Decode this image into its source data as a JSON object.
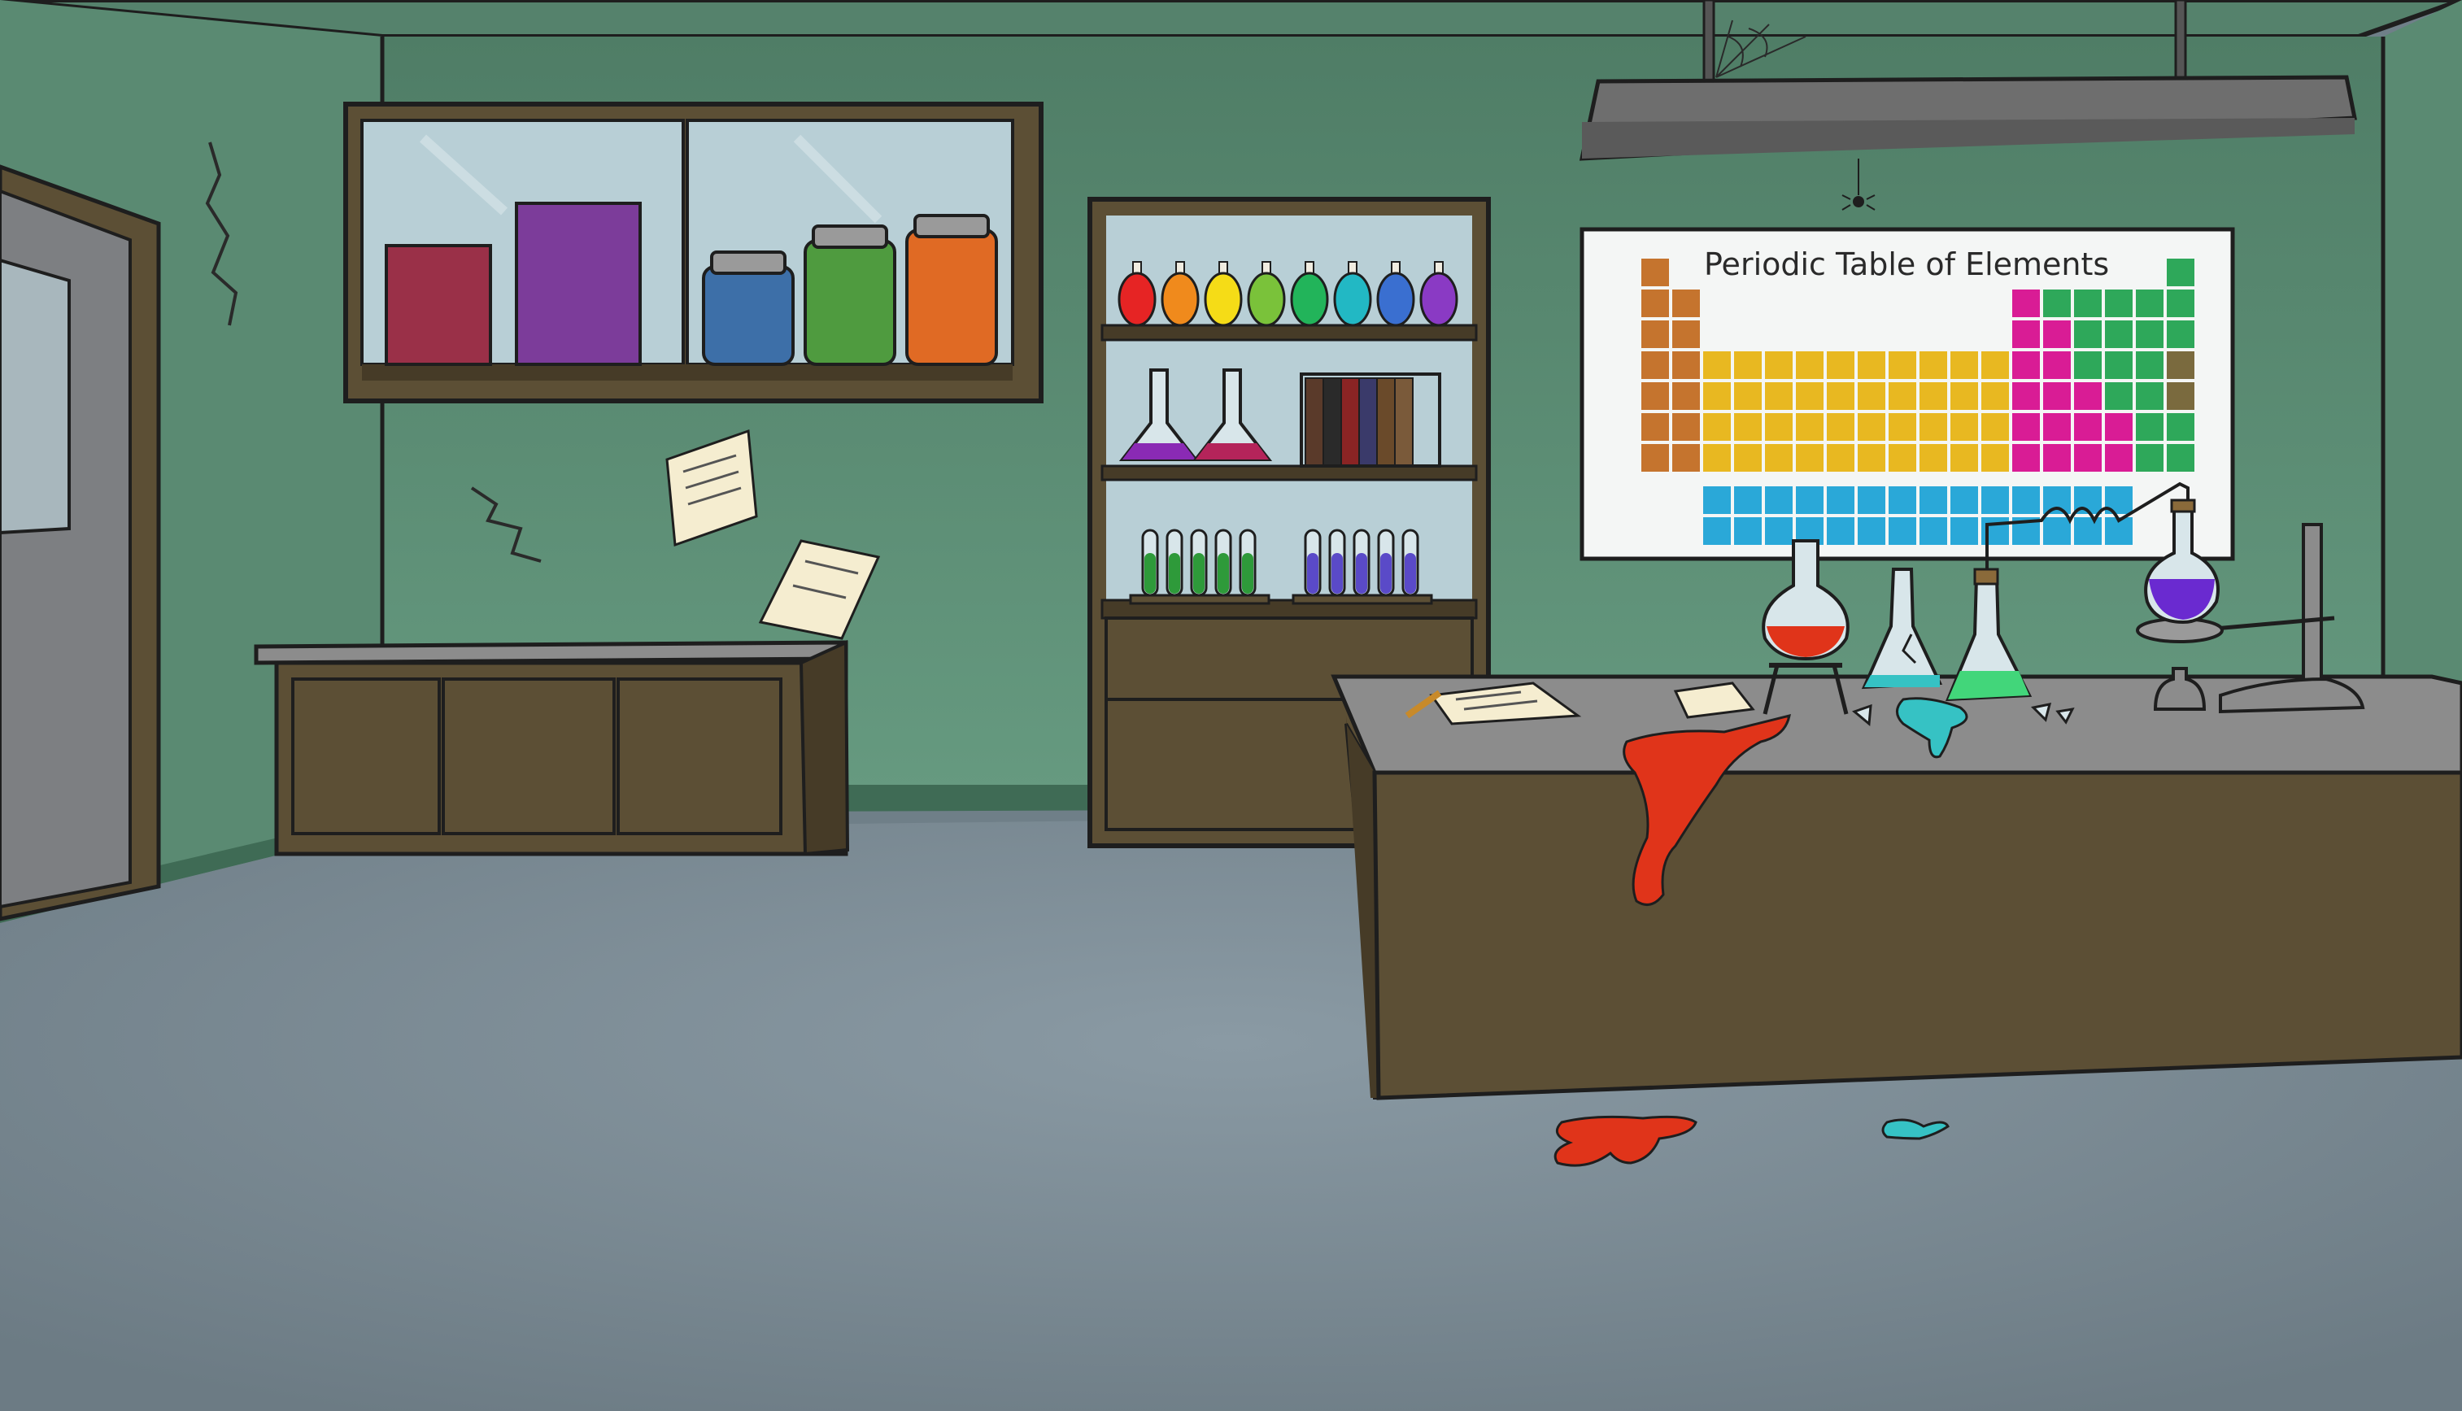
{
  "scene": {
    "periodic_table_poster": {
      "title": "Periodic Table of Elements"
    }
  },
  "colors": {
    "wall": "#5e9078",
    "wall_dark": "#4b7763",
    "ceiling": "#5b8a73",
    "floor": "#7a8a93",
    "cabinet_wood": "#5c4f35",
    "cabinet_wood_dark": "#463b27",
    "counter_top": "#8c8c8c",
    "spill_red": "#e0341a",
    "spill_cyan": "#36c2c4",
    "poster_bg": "#f4f6f5",
    "lamp": "#6e6e6e"
  },
  "bottles": [
    "#e62424",
    "#f08a1c",
    "#f5dc17",
    "#7ac23a",
    "#22b45a",
    "#22b8c4",
    "#3a6fd0",
    "#8a3ac4"
  ],
  "jars": [
    "#3d6fa8",
    "#4f9b3f",
    "#e06a24"
  ],
  "boxes": [
    "#9a3048",
    "#7c3c9a"
  ],
  "test_tubes_left": [
    "#2e9a3a",
    "#2e9a3a",
    "#2e9a3a",
    "#2e9a3a",
    "#2e9a3a"
  ],
  "test_tubes_right": [
    "#5a4ac8",
    "#5a4ac8",
    "#5a4ac8",
    "#5a4ac8",
    "#5a4ac8"
  ],
  "books": [
    "#5a3a2a",
    "#2a2a2a",
    "#8a2424",
    "#3a3a6a",
    "#6a4a2a",
    "#7a5a3a"
  ]
}
